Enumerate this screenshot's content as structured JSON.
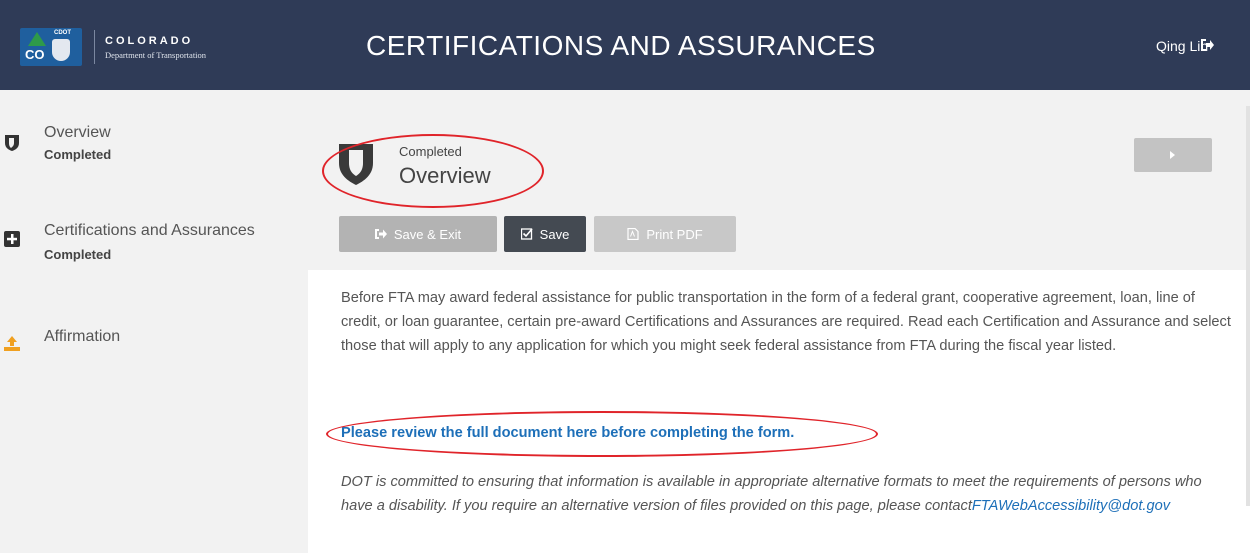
{
  "header": {
    "logo_small": "CDOT",
    "logo_co": "CO",
    "logo_line1": "COLORADO",
    "logo_line2": "Department of Transportation",
    "title": "CERTIFICATIONS AND ASSURANCES",
    "user_name": "Qing Lin"
  },
  "sidebar": {
    "items": [
      {
        "title": "Overview",
        "status": "Completed",
        "icon": "shield-icon"
      },
      {
        "title": "Certifications and Assurances",
        "status": "Completed",
        "icon": "plus-square-icon"
      },
      {
        "title": "Affirmation",
        "status": "",
        "icon": "upload-icon"
      }
    ]
  },
  "main": {
    "status_label": "Completed",
    "section_title": "Overview",
    "buttons": {
      "save_exit": "Save & Exit",
      "save": "Save",
      "print_pdf": "Print PDF"
    },
    "paragraph": "Before FTA may award federal assistance for public transportation in the form of a federal grant, cooperative agreement, loan, line of credit, or loan guarantee, certain pre-award Certifications and Assurances are required. Read each Certification and Assurance and select those that will apply to any application for which you might seek federal assistance from FTA during the fiscal year listed.",
    "review_link": "Please review the full document here before completing the form.",
    "note_text": "DOT is committed to ensuring that information is available in appropriate alternative formats to meet the requirements of persons who have a disability. If you require an alternative version of files provided on this page, please contact",
    "note_email": "FTAWebAccessibility@dot.gov"
  },
  "colors": {
    "header_bg": "#2f3b57",
    "sidebar_bg": "#f2f2f2",
    "link": "#1d6fb8",
    "annotation_red": "#e0242a",
    "save_button": "#444a52"
  }
}
